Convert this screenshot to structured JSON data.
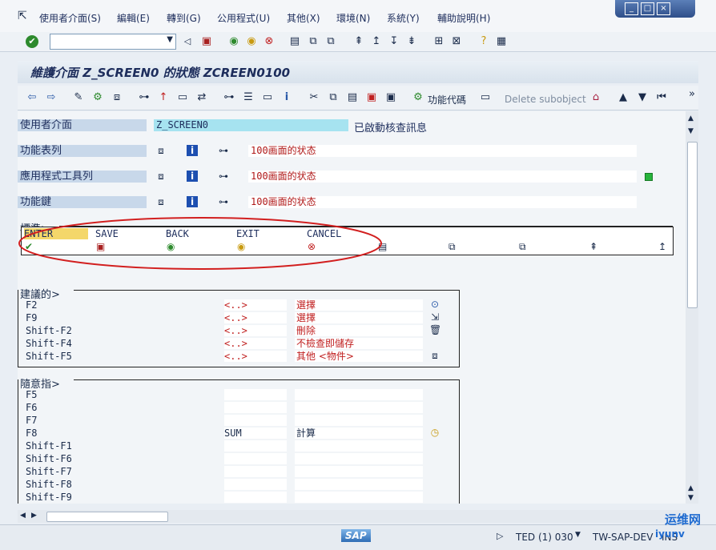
{
  "menubar": {
    "items": [
      "使用者介面(S)",
      "編輯(E)",
      "轉到(G)",
      "公用程式(U)",
      "其他(X)",
      "環境(N)",
      "系統(Y)",
      "輔助說明(H)"
    ]
  },
  "window_controls": {
    "minimize": "_",
    "maximize": "□",
    "close": "×"
  },
  "command_field": {
    "value": ""
  },
  "title": "維護介面 Z_SCREEN0 的狀態 ZCREEN0100",
  "toolbar2": {
    "function_code_label": "功能代碼",
    "delete_subobject_label": "Delete subobject"
  },
  "status": {
    "interface_label": "使用者介面",
    "interface_value": "Z_SCREEN0",
    "active_text": "已啟動核查訊息",
    "rows": [
      {
        "label": "功能表列",
        "text": "100画面的状态"
      },
      {
        "label": "應用程式工具列",
        "text": "100画面的状态"
      },
      {
        "label": "功能鍵",
        "text": "100画面的状态"
      }
    ]
  },
  "standard": {
    "title": "標準",
    "keys": [
      "ENTER",
      "SAVE",
      "BACK",
      "EXIT",
      "CANCEL",
      "",
      "",
      "",
      "",
      ""
    ]
  },
  "recommended": {
    "title": "建議的",
    "rows": [
      {
        "key": "F2",
        "code": "<..>",
        "text": "選擇"
      },
      {
        "key": "F9",
        "code": "<..>",
        "text": "選擇"
      },
      {
        "key": "Shift-F2",
        "code": "<..>",
        "text": "刪除"
      },
      {
        "key": "Shift-F4",
        "code": "<..>",
        "text": "不檢查即儲存"
      },
      {
        "key": "Shift-F5",
        "code": "<..>",
        "text": "其他 <物件>"
      }
    ]
  },
  "free": {
    "title": "隨意指",
    "rows": [
      {
        "key": "F5",
        "code": "",
        "text": ""
      },
      {
        "key": "F6",
        "code": "",
        "text": ""
      },
      {
        "key": "F7",
        "code": "",
        "text": ""
      },
      {
        "key": "F8",
        "code": "SUM",
        "text": "計算"
      },
      {
        "key": "Shift-F1",
        "code": "",
        "text": ""
      },
      {
        "key": "Shift-F6",
        "code": "",
        "text": ""
      },
      {
        "key": "Shift-F7",
        "code": "",
        "text": ""
      },
      {
        "key": "Shift-F8",
        "code": "",
        "text": ""
      },
      {
        "key": "Shift-F9",
        "code": "",
        "text": ""
      }
    ]
  },
  "statusbar": {
    "sap_logo": "SAP",
    "session": "TED (1) 030",
    "server": "TW-SAP-DEV",
    "mode": "INS"
  },
  "watermark": {
    "text": "运维网",
    "sub": "iyunv"
  },
  "colors": {
    "label_bg": "#c8d8ea",
    "highlight_cyan": "#a6e3f0",
    "annotation_red": "#d21f1f",
    "title_text": "#1d2d5c",
    "green_dot": "#28b43c"
  }
}
